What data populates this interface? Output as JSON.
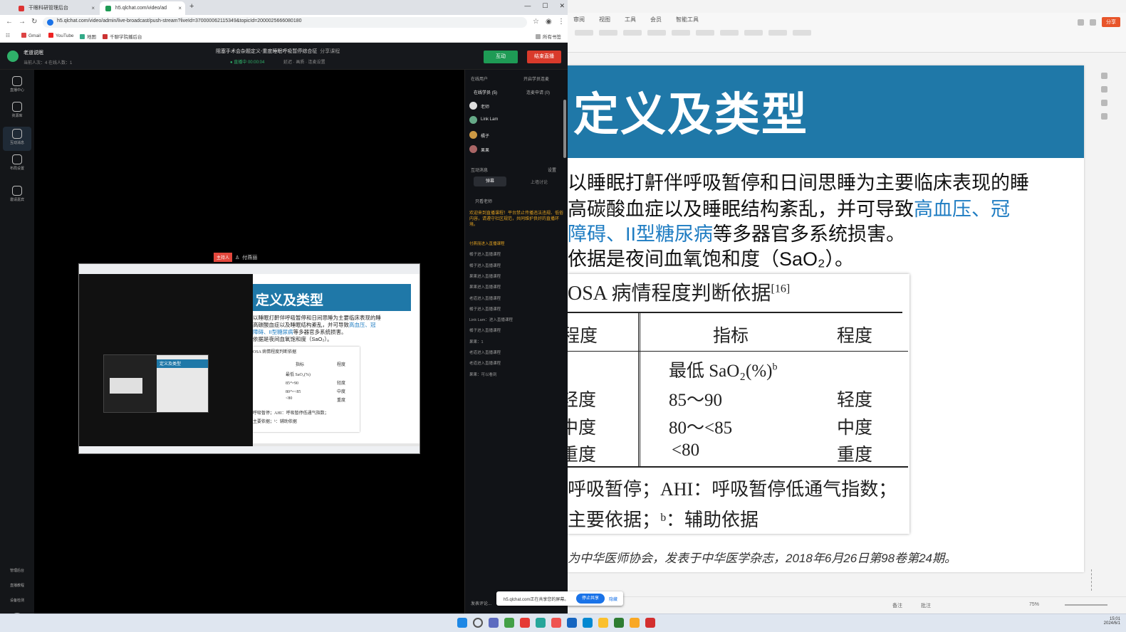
{
  "browser": {
    "tabs": [
      {
        "label": "干眼科研管理后台"
      },
      {
        "label": "h5.qlchat.com/video/ad"
      }
    ],
    "url": "h5.qlchat.com/video/admin/live-broadcast/push-stream?liveId=370000062115349&topicId=2000025666080180",
    "bookmarks": [
      "Gmail",
      "YouTube",
      "地图",
      "千聊学院播后台"
    ],
    "bookmark_right": "所有书签"
  },
  "live": {
    "channel_name": "老道说眠",
    "channel_sub": "当前人次：4    在线人数：1",
    "course_title": "阻塞手术会杂题定义-重度睡眠呼吸暂停综合征",
    "course_share": "分享课程",
    "status": "● 直播中 00:00:04",
    "stats": "延迟 · 画质 · 连麦设置",
    "btn_green": "互动",
    "btn_red": "结束直播",
    "rail": [
      "直播中心",
      "资源库",
      "互动消息",
      "布局设置",
      "邀请嘉宾"
    ],
    "rail_bottom": [
      "管理后台",
      "直播教程",
      "设备检测"
    ],
    "presenter_badge": "主持人",
    "presenter_name": "付燕丽",
    "panel": {
      "online_header": "在线用户",
      "guest_header": "开启学员连麦",
      "online_tab": "在线学员",
      "online_count": "5",
      "apply_tab": "连麦申请",
      "apply_count": "0",
      "users": [
        "老师",
        "Link Lam",
        "橘子",
        "果果"
      ],
      "chat_header": "互动消息",
      "chat_settings": "设置",
      "chat_tab_active": "弹幕",
      "chat_tab_other": "上墙讨论",
      "only_teacher": "只看老师",
      "welcome": "欢迎来到直播课程！平台禁止传播违法违规、低俗内容，请遵守社区规范，共同维护良好的直播环境。",
      "lines": [
        "付燕丽进入直播课程",
        "橘子进入直播课程",
        "橘子进入直播课程",
        "果果进入直播课程",
        "果果进入直播课程",
        "老道进入直播课程",
        "橘子进入直播课程",
        "Link Lam：进入直播课程",
        "橘子进入直播课程",
        "果果：1",
        "老道进入直播课程",
        "老道进入直播课程",
        "果果：可以看到"
      ],
      "bottom": "发表评论..."
    },
    "share_notice": "h5.qlchat.com正在共享您的屏幕。",
    "stop_share": "停止共享",
    "hide": "隐藏"
  },
  "ppt": {
    "menu": [
      "审阅",
      "视图",
      "工具",
      "会员",
      "智能工具"
    ],
    "share_button": "分享",
    "slide": {
      "title": "定义及类型",
      "line1": "以睡眠打鼾伴呼吸暂停和日间思睡为主要临床表现的睡",
      "line2_a": "高碳酸血症以及睡眠结构紊乱，并可导致",
      "line2_hl": "高血压、冠",
      "line3_hl": "障碍、II型糖尿病",
      "line3_b": "等多器官多系统损害。",
      "line4": "依据是夜间血氧饱和度（SaO₂）。",
      "table": {
        "caption": "OSA 病情程度判断依据",
        "caption_ref": "[16]",
        "headers": [
          "程度",
          "指标",
          "程度"
        ],
        "subheader": "最低 SaO₂(%)",
        "subheader_sup": "b",
        "rows": [
          {
            "level": "轻度",
            "value": "85～90",
            "grade": "轻度"
          },
          {
            "level": "中度",
            "value": "80～<85",
            "grade": "中度"
          },
          {
            "level": "重度",
            "value": "<80",
            "grade": "重度"
          }
        ],
        "note1": "呼吸暂停；AHI：呼吸暂停低通气指数；",
        "note2": "主要依据；ᵇ：辅助依据"
      },
      "footer": "为中华医师协会，发表于中华医学杂志，2018年6月26日第98卷第24期。"
    },
    "status": {
      "notes": "备注",
      "comments": "批注",
      "zoom": "75%"
    }
  },
  "taskbar": {
    "time": "15:01",
    "date": "2024/6/1"
  }
}
